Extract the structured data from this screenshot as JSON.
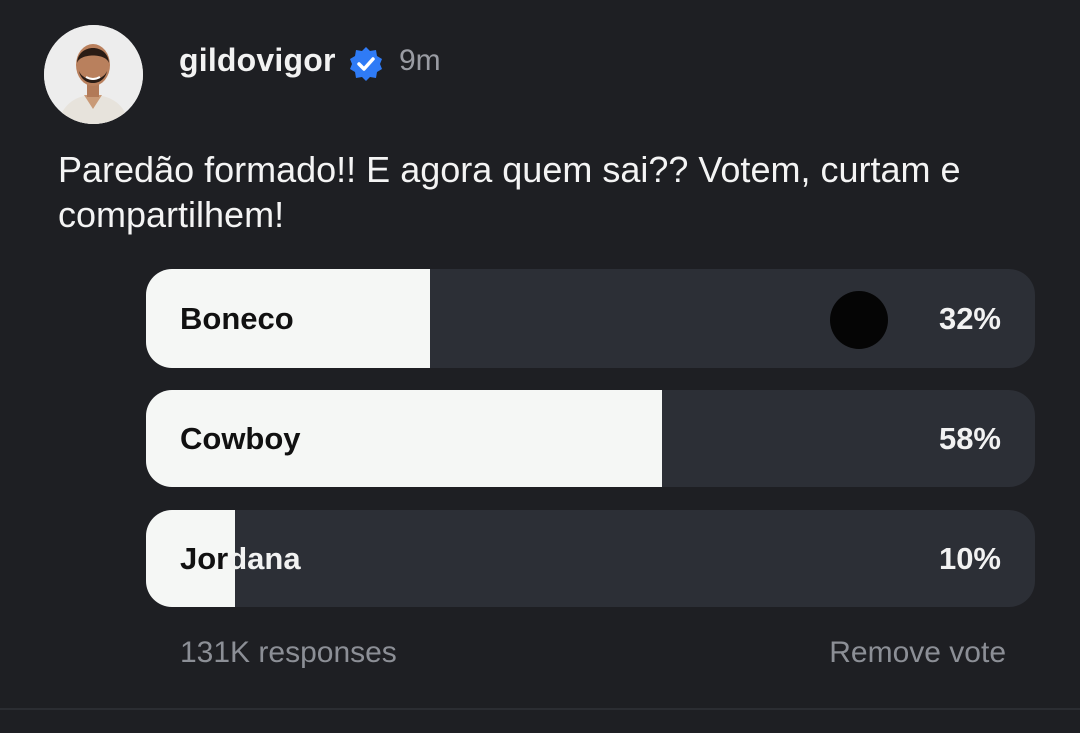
{
  "post": {
    "username": "gildovigor",
    "timestamp": "9m",
    "text": "Paredão formado!! E agora quem sai?? Votem, curtam e compartilhem!"
  },
  "poll": {
    "options": [
      {
        "label": "Boneco",
        "percent_label": "32%",
        "fill_fraction": 0.32,
        "voted": true
      },
      {
        "label": "Cowboy",
        "percent_label": "58%",
        "fill_fraction": 0.58,
        "voted": false
      },
      {
        "label": "Jordana",
        "label_part1": "Jor",
        "label_part2": "dana",
        "percent_label": "10%",
        "fill_fraction": 0.1,
        "voted": false
      }
    ],
    "responses": "131K responses",
    "remove_vote": "Remove vote"
  },
  "icons": {
    "verified": "verified-badge-icon",
    "avatar": "profile-photo"
  },
  "colors": {
    "background": "#1e1f23",
    "poll_track": "#2c2f36",
    "poll_fill": "#f5f7f5",
    "verified": "#2f7bf6",
    "muted_text": "#8c8f96"
  }
}
